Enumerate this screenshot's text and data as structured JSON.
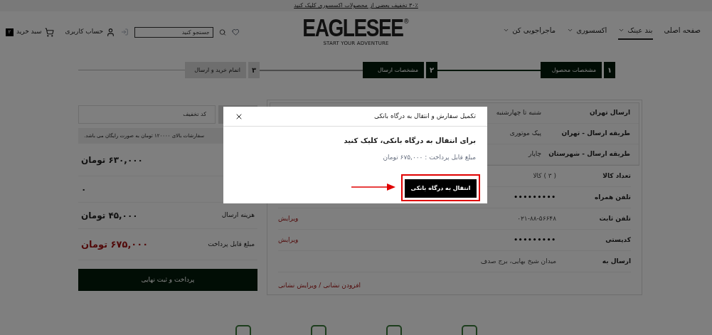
{
  "promo_bar": {
    "text": "۳۰٪ تخفیف بعضی از محصولات اکسسوری کلیک کنید"
  },
  "header": {
    "nav": [
      {
        "label": "صفحه اصلی",
        "dropdown": false,
        "selected": false
      },
      {
        "label": "بند عینک",
        "dropdown": true,
        "selected": true
      },
      {
        "label": "اکسسوری",
        "dropdown": true,
        "selected": false
      },
      {
        "label": "ماجراجویی کن",
        "dropdown": true,
        "selected": false
      }
    ],
    "logo": {
      "name": "EAGLESEE",
      "mark": "®",
      "tagline": "START YOUR ADVENTURE"
    },
    "search": {
      "placeholder": "جستجو کنید"
    },
    "account": "حساب کاربری",
    "cart": {
      "label": "سبد خرید",
      "count": "۲"
    }
  },
  "steps": [
    {
      "number": "۱",
      "label": "مشخصات محصول",
      "done": true
    },
    {
      "number": "۲",
      "label": "مشخصات ارسال",
      "done": true
    },
    {
      "number": "۳",
      "label": "اتمام خرید و ارسال",
      "done": false
    }
  ],
  "shipping": [
    {
      "label": "ارسال تهران",
      "value": "شنبه تا چهارشنبه"
    },
    {
      "label": "طریقه ارسال - تهران",
      "value": "پیک موتوری"
    },
    {
      "label": "طریقه ارسال - شهرستان",
      "value": "چاپار"
    }
  ],
  "details": [
    {
      "label": "تعداد کالا",
      "value": "( ۳ ) کالا",
      "muted": true
    },
    {
      "label": "تلفن همراه",
      "value": "•••••••••",
      "muted": false
    },
    {
      "label": "تلفن ثابت",
      "value": "۰۲۱-۸۸-۵۶۶۴۸",
      "muted": true,
      "action": "ویرایش"
    },
    {
      "label": "کدپستی",
      "value": "•••••••••",
      "muted": false,
      "action": "ویرایش"
    },
    {
      "label": "ارسال به",
      "value": "میدان شیخ بهایی، برج صدف",
      "muted": true
    }
  ],
  "address_link": "افزودن نشانی / ویرایش نشانی",
  "summary": {
    "discount": {
      "placeholder": "کد تخفیف"
    },
    "notice": "سفارشات بالای ۱۲۰۰۰۰ تومان به صورت رایگان می باشد.",
    "rows": [
      {
        "value": "۶۳۰,۰۰۰ تومان",
        "highlight": false
      },
      {
        "value": "۰",
        "highlight": false
      },
      {
        "label": "هزینه ارسال",
        "value": "۴۵,۰۰۰ تومان",
        "highlight": false
      },
      {
        "label": "مبلغ قابل پرداخت",
        "value": "۶۷۵,۰۰۰ تومان",
        "highlight": true
      }
    ],
    "pay_button": "پرداخت و ثبت نهایی"
  },
  "modal": {
    "title": "تکمیل سفارش و انتقال به درگاه بانکی",
    "message": "برای انتقال به درگاه بانکی، کلیک کنید",
    "amount": "مبلغ قابل پرداخت : ۶۷۵,۰۰۰ تومان",
    "button": "انتقال به درگاه بانکی"
  }
}
